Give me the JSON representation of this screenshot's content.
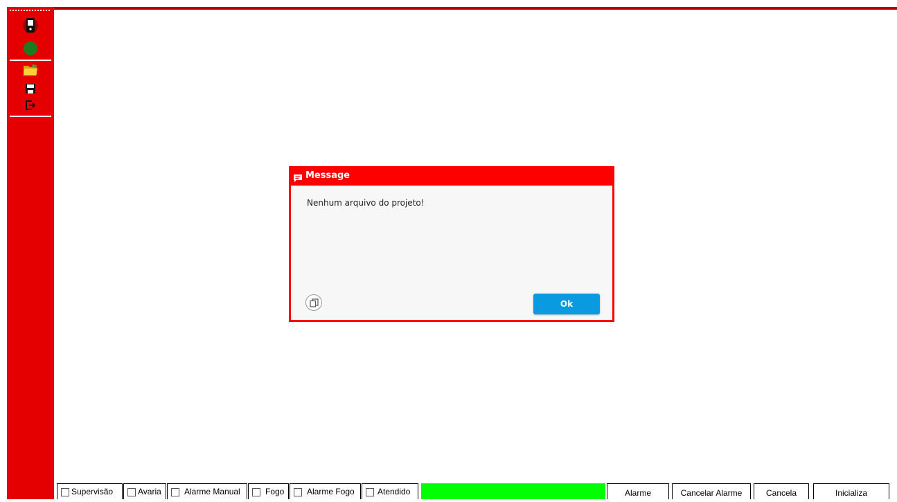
{
  "colors": {
    "accent": "#e50000",
    "dialog_frame": "#ff0000",
    "ok_button": "#0a9ae0",
    "status_green": "#00ff00"
  },
  "sidebar": {
    "icons": [
      "device-icon",
      "status-indicator-icon",
      "open-folder-icon",
      "save-icon",
      "exit-icon"
    ]
  },
  "dialog": {
    "title": "Message",
    "message": "Nenhum arquivo do projeto!",
    "ok_label": "Ok",
    "copy_icon": "copy-icon"
  },
  "statusbar": {
    "checkboxes": [
      {
        "label": "Supervisão",
        "checked": false
      },
      {
        "label": "Avaria",
        "checked": false
      },
      {
        "label": "Alarme Manual",
        "checked": false
      },
      {
        "label": "Fogo",
        "checked": false
      },
      {
        "label": "Alarme Fogo",
        "checked": false
      },
      {
        "label": "Atendido",
        "checked": false
      }
    ],
    "buttons": {
      "alarme": "Alarme",
      "cancelar_alarme": "Cancelar Alarme",
      "cancela": "Cancela",
      "inicializa": "Inicializa"
    }
  }
}
